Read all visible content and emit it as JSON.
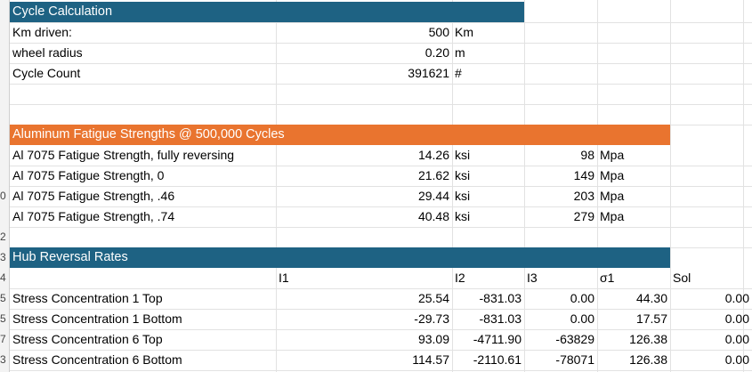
{
  "cycle": {
    "title": "Cycle Calculation",
    "rows": [
      {
        "label": "Km driven:",
        "value": "500",
        "unit": "Km"
      },
      {
        "label": "wheel radius",
        "value": "0.20",
        "unit": "m"
      },
      {
        "label": "Cycle Count",
        "value": "391621",
        "unit": "#"
      }
    ]
  },
  "fatigue": {
    "title": "Aluminum Fatigue Strengths @ 500,000 Cycles",
    "rows": [
      {
        "label": "Al 7075 Fatigue Strength, fully reversing",
        "ksi": "14.26",
        "ksi_unit": "ksi",
        "mpa": "98",
        "mpa_unit": "Mpa"
      },
      {
        "label": "Al 7075 Fatigue Strength, 0",
        "ksi": "21.62",
        "ksi_unit": "ksi",
        "mpa": "149",
        "mpa_unit": "Mpa"
      },
      {
        "label": "Al 7075 Fatigue Strength, .46",
        "ksi": "29.44",
        "ksi_unit": "ksi",
        "mpa": "203",
        "mpa_unit": "Mpa"
      },
      {
        "label": "Al 7075 Fatigue Strength, .74",
        "ksi": "40.48",
        "ksi_unit": "ksi",
        "mpa": "279",
        "mpa_unit": "Mpa"
      }
    ]
  },
  "hub": {
    "title": "Hub Reversal Rates",
    "headers": {
      "i1": "I1",
      "i2": "I2",
      "i3": "I3",
      "s1": "σ1",
      "sol": "Sol"
    },
    "rows": [
      {
        "label": "Stress Concentration 1 Top",
        "i1": "25.54",
        "i2": "-831.03",
        "i3": "0.00",
        "s1": "44.30",
        "sol": "0.00"
      },
      {
        "label": "Stress Concentration 1 Bottom",
        "i1": "-29.73",
        "i2": "-831.03",
        "i3": "0.00",
        "s1": "17.57",
        "sol": "0.00"
      },
      {
        "label": "Stress Concentration 6 Top",
        "i1": "93.09",
        "i2": "-4711.90",
        "i3": "-63829",
        "s1": "126.38",
        "sol": "0.00"
      },
      {
        "label": "Stress Concentration 6 Bottom",
        "i1": "114.57",
        "i2": "-2110.61",
        "i3": "-78071",
        "s1": "126.38",
        "sol": "0.00"
      }
    ]
  },
  "row_header_digits": [
    "0",
    "2",
    "3",
    "4",
    "5",
    "5",
    "7",
    "3"
  ],
  "colors": {
    "section_blue": "#1e6283",
    "section_orange": "#e9742f",
    "grid": "#e2e2e2"
  }
}
